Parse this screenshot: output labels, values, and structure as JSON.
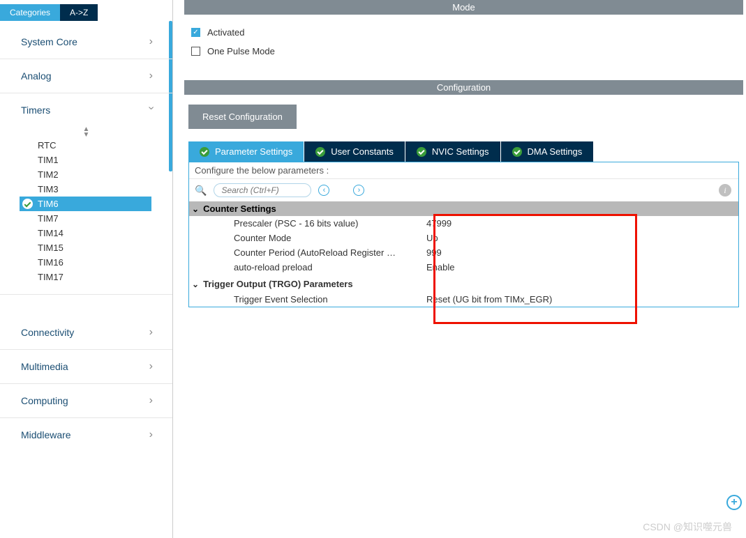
{
  "sidebar": {
    "tabs": {
      "categories": "Categories",
      "az": "A->Z"
    },
    "groups": [
      {
        "label": "System Core",
        "expanded": false
      },
      {
        "label": "Analog",
        "expanded": false
      },
      {
        "label": "Timers",
        "expanded": true
      },
      {
        "label": "Connectivity",
        "expanded": false
      },
      {
        "label": "Multimedia",
        "expanded": false
      },
      {
        "label": "Computing",
        "expanded": false
      },
      {
        "label": "Middleware",
        "expanded": false
      }
    ],
    "timers": [
      {
        "label": "RTC",
        "selected": false
      },
      {
        "label": "TIM1",
        "selected": false
      },
      {
        "label": "TIM2",
        "selected": false
      },
      {
        "label": "TIM3",
        "selected": false
      },
      {
        "label": "TIM6",
        "selected": true
      },
      {
        "label": "TIM7",
        "selected": false
      },
      {
        "label": "TIM14",
        "selected": false
      },
      {
        "label": "TIM15",
        "selected": false
      },
      {
        "label": "TIM16",
        "selected": false
      },
      {
        "label": "TIM17",
        "selected": false
      }
    ]
  },
  "mode": {
    "header": "Mode",
    "activated_label": "Activated",
    "activated_checked": true,
    "one_pulse_label": "One Pulse Mode",
    "one_pulse_checked": false
  },
  "configuration": {
    "header": "Configuration",
    "reset_label": "Reset Configuration",
    "tabs": [
      {
        "label": "Parameter Settings",
        "active": true
      },
      {
        "label": "User Constants",
        "active": false
      },
      {
        "label": "NVIC Settings",
        "active": false
      },
      {
        "label": "DMA Settings",
        "active": false
      }
    ],
    "desc": "Configure the below parameters :",
    "search_placeholder": "Search (Ctrl+F)",
    "counter_section": "Counter Settings",
    "counter_rows": [
      {
        "label": "Prescaler (PSC - 16 bits value)",
        "value": "47999"
      },
      {
        "label": "Counter Mode",
        "value": "Up"
      },
      {
        "label": "Counter Period (AutoReload Register …",
        "value": "999"
      },
      {
        "label": "auto-reload preload",
        "value": "Enable"
      }
    ],
    "trgo_section": "Trigger Output (TRGO) Parameters",
    "trgo_rows": [
      {
        "label": "Trigger Event Selection",
        "value": "Reset (UG bit from TIMx_EGR)"
      }
    ]
  },
  "watermark": "CSDN @知识噬元兽"
}
